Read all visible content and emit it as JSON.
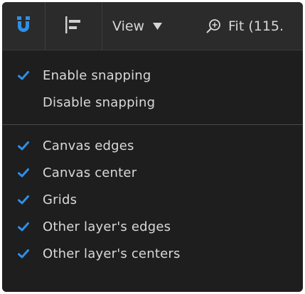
{
  "toolbar": {
    "magnet_icon": "magnet-icon",
    "align_icon": "align-left-icon",
    "view_label": "View",
    "view_caret_icon": "caret-down-icon",
    "zoom_icon": "zoom-in-icon",
    "zoom_label": "Fit (115."
  },
  "menu": {
    "snapping": [
      {
        "label": "Enable snapping",
        "checked": true
      },
      {
        "label": "Disable snapping",
        "checked": false
      }
    ],
    "targets": [
      {
        "label": "Canvas edges",
        "checked": true
      },
      {
        "label": "Canvas center",
        "checked": true
      },
      {
        "label": "Grids",
        "checked": true
      },
      {
        "label": "Other layer's edges",
        "checked": true
      },
      {
        "label": "Other layer's centers",
        "checked": true
      }
    ]
  },
  "colors": {
    "accent": "#2f8fe8",
    "background": "#1e1e1e",
    "toolbar": "#2b2b2b",
    "text": "#d9d9d9"
  }
}
